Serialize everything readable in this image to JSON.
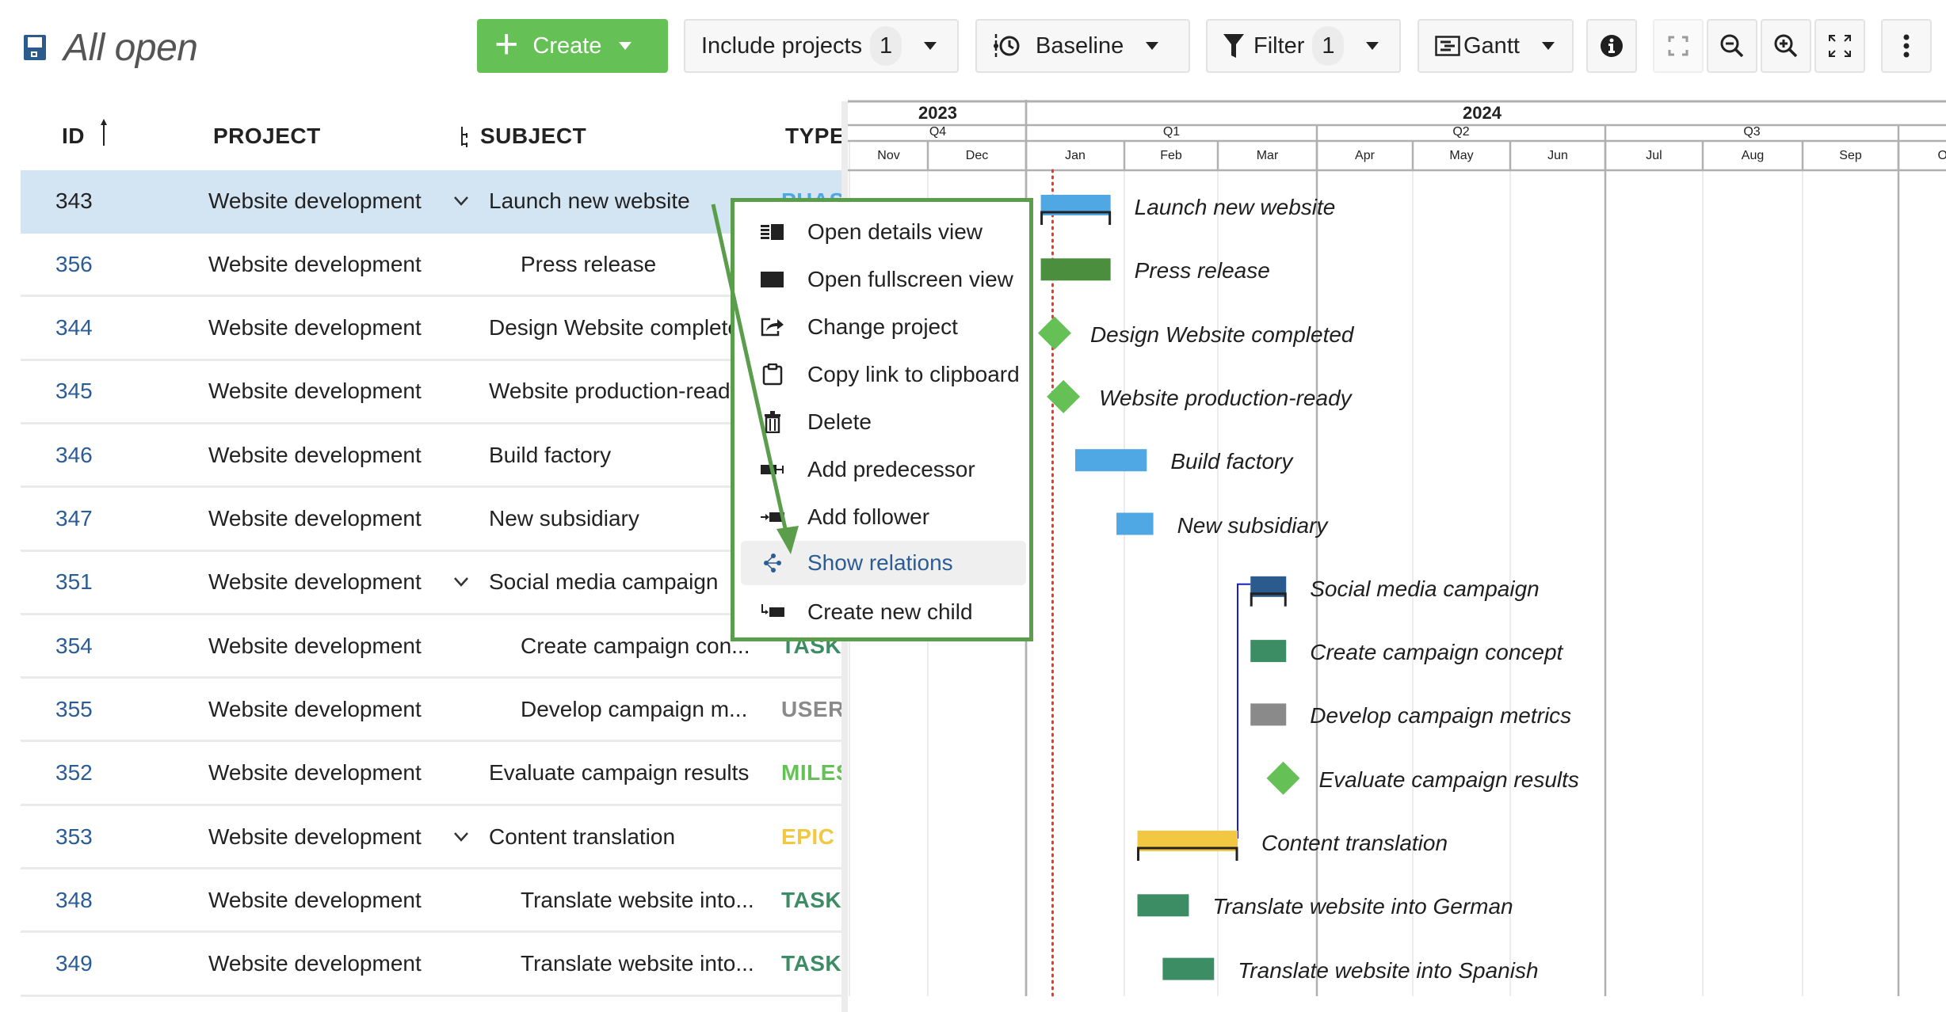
{
  "header": {
    "title": "All open",
    "save_icon": "floppy-disk-icon"
  },
  "toolbar": {
    "create_label": "Create",
    "include_projects_label": "Include projects",
    "include_projects_count": "1",
    "baseline_label": "Baseline",
    "filter_label": "Filter",
    "filter_count": "1",
    "view_label": "Gantt",
    "icons": [
      "info-icon",
      "zoom-to-fit-icon",
      "zoom-out-icon",
      "zoom-in-icon",
      "fullscreen-icon",
      "more-vertical-icon"
    ]
  },
  "table": {
    "columns": {
      "id": "ID",
      "project": "PROJECT",
      "subject": "SUBJECT",
      "type": "TYPE"
    },
    "sort": "id-ascending",
    "rows": [
      {
        "id": "343",
        "project": "Website development",
        "subject": "Launch new website",
        "type": "PHASE",
        "type_color": "#4fa8e4",
        "indent": 0,
        "expandable": true,
        "selected": true
      },
      {
        "id": "356",
        "project": "Website development",
        "subject": "Press release",
        "type": "",
        "type_color": "#4b8f3e",
        "indent": 1,
        "expandable": false
      },
      {
        "id": "344",
        "project": "Website development",
        "subject": "Design Website completed",
        "type": "",
        "type_color": "#65c155",
        "indent": 0,
        "expandable": false
      },
      {
        "id": "345",
        "project": "Website development",
        "subject": "Website production-ready",
        "type": "",
        "type_color": "#65c155",
        "indent": 0,
        "expandable": false
      },
      {
        "id": "346",
        "project": "Website development",
        "subject": "Build factory",
        "type": "",
        "type_color": "#4fa8e4",
        "indent": 0,
        "expandable": false
      },
      {
        "id": "347",
        "project": "Website development",
        "subject": "New subsidiary",
        "type": "",
        "type_color": "#4fa8e4",
        "indent": 0,
        "expandable": false
      },
      {
        "id": "351",
        "project": "Website development",
        "subject": "Social media campaign",
        "type": "",
        "type_color": "#2b5a8c",
        "indent": 0,
        "expandable": true
      },
      {
        "id": "354",
        "project": "Website development",
        "subject": "Create campaign con...",
        "type": "TASK",
        "type_color": "#3c8c64",
        "indent": 1,
        "expandable": false
      },
      {
        "id": "355",
        "project": "Website development",
        "subject": "Develop campaign m...",
        "type": "USER",
        "type_color": "#8a8a8a",
        "indent": 1,
        "expandable": false
      },
      {
        "id": "352",
        "project": "Website development",
        "subject": "Evaluate campaign results",
        "type": "MILES",
        "type_color": "#65c155",
        "indent": 0,
        "expandable": false
      },
      {
        "id": "353",
        "project": "Website development",
        "subject": "Content translation",
        "type": "EPIC",
        "type_color": "#f2c741",
        "indent": 0,
        "expandable": true
      },
      {
        "id": "348",
        "project": "Website development",
        "subject": "Translate website into...",
        "type": "TASK",
        "type_color": "#3c8c64",
        "indent": 1,
        "expandable": false
      },
      {
        "id": "349",
        "project": "Website development",
        "subject": "Translate website into...",
        "type": "TASK",
        "type_color": "#3c8c64",
        "indent": 1,
        "expandable": false
      }
    ]
  },
  "gantt": {
    "years": [
      {
        "label": "2023",
        "from": 0,
        "to": 2
      },
      {
        "label": "2024",
        "from": 2,
        "to": 12
      }
    ],
    "quarters": [
      {
        "label": "Q4",
        "from": 0,
        "to": 2
      },
      {
        "label": "Q1",
        "from": 2,
        "to": 5
      },
      {
        "label": "Q2",
        "from": 5,
        "to": 8
      },
      {
        "label": "Q3",
        "from": 8,
        "to": 11
      },
      {
        "label": "",
        "from": 11,
        "to": 12
      }
    ],
    "months": [
      "Nov",
      "Dec",
      "Jan",
      "Feb",
      "Mar",
      "Apr",
      "May",
      "Jun",
      "Jul",
      "Aug",
      "Sep",
      "Oct"
    ],
    "today_month_offset": 2.27,
    "items": [
      {
        "label": "Launch new website",
        "kind": "parent",
        "start": 2.15,
        "end": 2.86,
        "color": "#4fa8e4"
      },
      {
        "label": "Press release",
        "kind": "bar",
        "start": 2.15,
        "end": 2.86,
        "color": "#4b8f3e"
      },
      {
        "label": "Design Website completed",
        "kind": "milestone",
        "at": 2.29,
        "color": "#65c155"
      },
      {
        "label": "Website production-ready",
        "kind": "milestone",
        "at": 2.38,
        "color": "#65c155"
      },
      {
        "label": "Build factory",
        "kind": "bar",
        "start": 2.5,
        "end": 3.24,
        "color": "#4fa8e4"
      },
      {
        "label": "New subsidiary",
        "kind": "bar",
        "start": 2.92,
        "end": 3.31,
        "color": "#4fa8e4"
      },
      {
        "label": "Social media campaign",
        "kind": "parent",
        "start": 4.33,
        "end": 4.69,
        "color": "#2b5a8c"
      },
      {
        "label": "Create campaign concept",
        "kind": "bar",
        "start": 4.33,
        "end": 4.69,
        "color": "#3c8c64"
      },
      {
        "label": "Develop campaign metrics",
        "kind": "bar",
        "start": 4.33,
        "end": 4.69,
        "color": "#8a8a8a"
      },
      {
        "label": "Evaluate campaign results",
        "kind": "milestone",
        "at": 4.66,
        "color": "#65c155"
      },
      {
        "label": "Content translation",
        "kind": "parent",
        "start": 3.14,
        "end": 4.2,
        "color": "#f2c741"
      },
      {
        "label": "Translate website into German",
        "kind": "bar",
        "start": 3.14,
        "end": 3.69,
        "color": "#3c8c64"
      },
      {
        "label": "Translate website into Spanish",
        "kind": "bar",
        "start": 3.41,
        "end": 3.96,
        "color": "#3c8c64"
      }
    ],
    "relation": {
      "from_row": 10,
      "to_row": 6,
      "color": "#1a1adc"
    }
  },
  "context_menu": {
    "items": [
      {
        "label": "Open details view",
        "icon": "details-view-icon"
      },
      {
        "label": "Open fullscreen view",
        "icon": "fullscreen-view-icon"
      },
      {
        "label": "Change project",
        "icon": "move-icon"
      },
      {
        "label": "Copy link to clipboard",
        "icon": "clipboard-icon"
      },
      {
        "label": "Delete",
        "icon": "trash-icon"
      },
      {
        "label": "Add predecessor",
        "icon": "add-predecessor-icon"
      },
      {
        "label": "Add follower",
        "icon": "add-follower-icon"
      },
      {
        "label": "Show relations",
        "icon": "relations-icon",
        "active": true
      },
      {
        "label": "Create new child",
        "icon": "create-child-icon"
      }
    ]
  },
  "colors": {
    "accent_green": "#65c155",
    "link_blue": "#2a5c96",
    "selected_row": "#d3e4f3",
    "annotation_green": "#5a9e4b",
    "today_line": "#e03c31"
  }
}
